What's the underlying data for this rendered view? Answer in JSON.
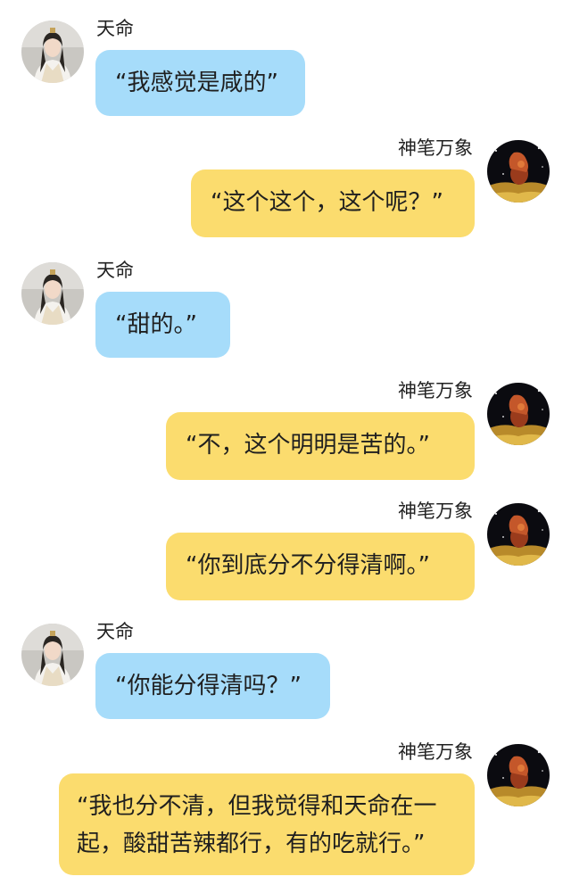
{
  "messages": [
    {
      "sender": "天命",
      "side": "left",
      "text": "“我感觉是咸的”"
    },
    {
      "sender": "神笔万象",
      "side": "right",
      "text": "“这个这个，这个呢？”"
    },
    {
      "sender": "天命",
      "side": "left",
      "text": "“甜的。”"
    },
    {
      "sender": "神笔万象",
      "side": "right",
      "text": "“不，这个明明是苦的。”"
    },
    {
      "sender": "神笔万象",
      "side": "right",
      "text": "“你到底分不分得清啊。”"
    },
    {
      "sender": "天命",
      "side": "left",
      "text": "“你能分得清吗？”"
    },
    {
      "sender": "神笔万象",
      "side": "right",
      "lines": [
        "“我也分不清，但我觉得和天命在一",
        "起，酸甜苦辣都行，有的吃就行。”"
      ]
    }
  ],
  "colors": {
    "left_bubble": "#a6dcfa",
    "right_bubble": "#fbdc6e",
    "text": "#1f1f1f",
    "background": "#ffffff"
  },
  "icons": {
    "left_avatar": "person-avatar-icon",
    "right_avatar": "cosmic-painting-avatar-icon"
  }
}
